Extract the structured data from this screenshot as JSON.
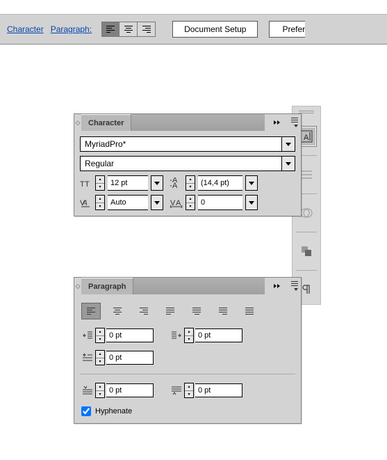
{
  "topbar": {
    "char_link": "Character",
    "para_link": "Paragraph",
    "doc_setup": "Document Setup",
    "prefs": "Prefer"
  },
  "char_panel": {
    "title": "Character",
    "font": "MyriadPro*",
    "style": "Regular",
    "size": "12 pt",
    "leading": "(14,4 pt)",
    "kerning": "Auto",
    "tracking": "0"
  },
  "para_panel": {
    "title": "Paragraph",
    "indent_left": "0 pt",
    "indent_right": "0 pt",
    "indent_first": "0 pt",
    "space_before": "0 pt",
    "space_after": "0 pt",
    "hyphenate": "Hyphenate"
  }
}
